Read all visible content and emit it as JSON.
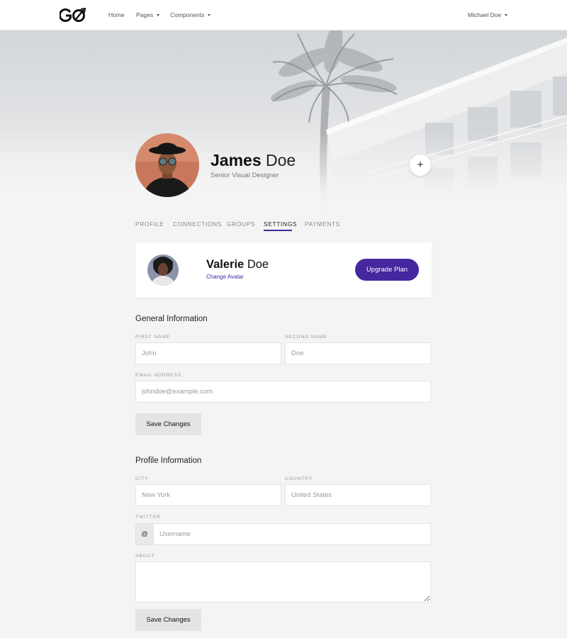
{
  "navbar": {
    "logo_text": "GO",
    "links": [
      {
        "label": "Home"
      },
      {
        "label": "Pages"
      },
      {
        "label": "Components"
      }
    ],
    "user_menu": "Michael Doe"
  },
  "profile": {
    "first_name": "James",
    "last_name": "Doe",
    "title": "Senior Visual Designer",
    "add_button": "+"
  },
  "tabs": [
    {
      "label": "PROFILE",
      "active": false
    },
    {
      "label": "CONNECTIONS",
      "active": false
    },
    {
      "label": "GROUPS",
      "active": false
    },
    {
      "label": "SETTINGS",
      "active": true
    },
    {
      "label": "PAYMENTS",
      "active": false
    }
  ],
  "account_card": {
    "first_name": "Valerie",
    "last_name": "Doe",
    "change_avatar": "Change Avatar",
    "upgrade_button": "Upgrade Plan"
  },
  "general": {
    "title": "General Information",
    "first_name_label": "FIRST NAME",
    "first_name_placeholder": "John",
    "second_name_label": "SECOND NAME",
    "second_name_placeholder": "Doe",
    "email_label": "EMAIL ADDRESS",
    "email_placeholder": "johndoe@example.com",
    "save_button": "Save Changes"
  },
  "profile_info": {
    "title": "Profile Information",
    "city_label": "CITY",
    "city_placeholder": "New York",
    "country_label": "COUNTRY",
    "country_placeholder": "United States",
    "twitter_label": "TWITTER",
    "twitter_prefix": "@",
    "twitter_placeholder": "Username",
    "about_label": "ABOUT",
    "about_placeholder": "",
    "save_button": "Save Changes"
  },
  "colors": {
    "accent": "#4527a0",
    "background": "#f4f4f4"
  }
}
